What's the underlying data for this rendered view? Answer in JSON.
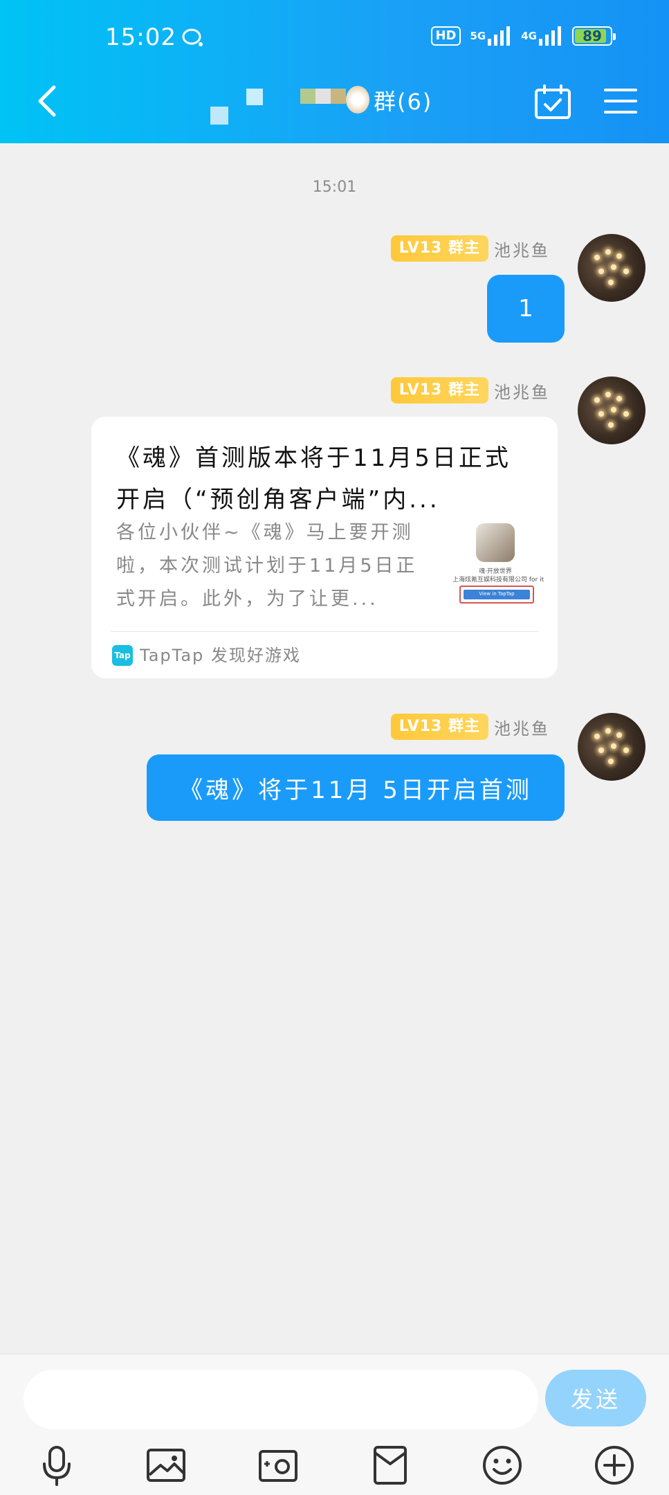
{
  "status_bar": {
    "time": "15:02",
    "hd_label": "HD",
    "signal_1_label": "5G",
    "signal_2_label": "4G",
    "battery": "89",
    "battery_level": 0.89
  },
  "header": {
    "group_title": "群(6)"
  },
  "chat": {
    "timestamp": "15:01",
    "messages": [
      {
        "badge": "LV13 群主",
        "sender": "池兆鱼",
        "text": "1"
      },
      {
        "badge": "LV13 群主",
        "sender": "池兆鱼",
        "card": {
          "title": "《魂》首测版本将于11月5日正式开启（“预创角客户端”内...",
          "description": "各位小伙伴~《魂》马上要开测啦，本次测试计划于11月5日正式开启。此外，为了让更...",
          "thumb_line_1": "魂·开放世界",
          "thumb_line_2": "上海炫氪互娱科技有限公司 for it",
          "thumb_button": "View in TapTap",
          "source_icon": "Tap",
          "source": "TapTap 发现好游戏"
        }
      },
      {
        "badge": "LV13 群主",
        "sender": "池兆鱼",
        "text": "《魂》将于11月 5日开启首测"
      }
    ]
  },
  "input_bar": {
    "placeholder": "",
    "send_label": "发送",
    "tools": [
      "microphone-icon",
      "image-icon",
      "camera-icon",
      "red-packet-icon",
      "emoji-icon",
      "plus-icon"
    ]
  },
  "colors": {
    "header_gradient_start": "#00c3f5",
    "header_gradient_end": "#1592f5",
    "bubble": "#1a9bfa",
    "badge": "#ffc83a",
    "send_button": "#94d3fb"
  }
}
